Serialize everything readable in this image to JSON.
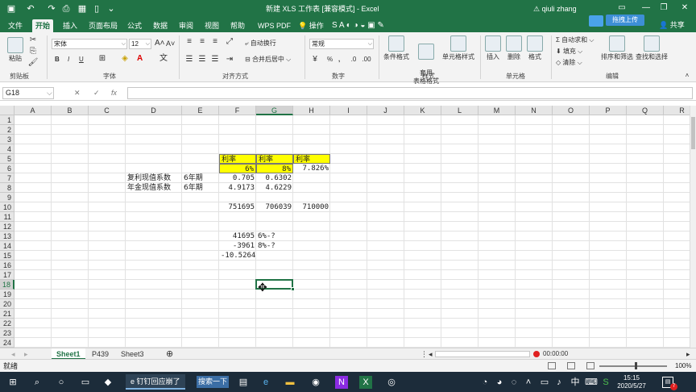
{
  "window": {
    "title": "新建 XLS 工作表 [兼容模式] - Excel",
    "user": "qiuli zhang",
    "upload_label": "拖拽上传",
    "share_label": "共享",
    "minimize": "—",
    "restore": "❐",
    "close": "✕"
  },
  "tabs": [
    "文件",
    "开始",
    "插入",
    "页面布局",
    "公式",
    "数据",
    "审阅",
    "视图",
    "帮助",
    "WPS PDF",
    "操作"
  ],
  "active_tab": "开始",
  "ribbon": {
    "clipboard": {
      "paste": "粘贴",
      "label": "剪贴板"
    },
    "font": {
      "name": "宋体",
      "size": "12",
      "label": "字体",
      "bold": "B",
      "italic": "I",
      "underline": "U",
      "grow": "A",
      "shrink": "A",
      "color_glyph": "A"
    },
    "alignment": {
      "wrap": "自动换行",
      "merge": "合并后居中",
      "label": "对齐方式"
    },
    "number": {
      "format": "常规",
      "label": "数字",
      "percent": "%",
      "comma": ","
    },
    "styles": {
      "conditional": "条件格式",
      "table": "套用\n表格格式",
      "cell_styles": "单元格样式",
      "label": "样式"
    },
    "cells": {
      "insert": "插入",
      "delete": "删除",
      "format": "格式",
      "label": "单元格"
    },
    "editing": {
      "autosum": "自动求和",
      "fill": "填充",
      "clear": "清除",
      "sort": "排序和筛选",
      "find": "查找和选择",
      "label": "编辑"
    }
  },
  "formula_bar": {
    "name_box": "G18",
    "cancel": "✕",
    "enter": "✓",
    "fx": "fx",
    "value": ""
  },
  "columns": [
    "A",
    "B",
    "C",
    "D",
    "E",
    "F",
    "G",
    "H",
    "I",
    "J",
    "K",
    "L",
    "M",
    "N",
    "O",
    "P",
    "Q",
    "R"
  ],
  "rows": [
    "1",
    "2",
    "3",
    "4",
    "5",
    "6",
    "7",
    "8",
    "9",
    "10",
    "11",
    "12",
    "13",
    "14",
    "15",
    "16",
    "17",
    "18",
    "19",
    "20",
    "21",
    "22",
    "23",
    "24"
  ],
  "selected_cell": {
    "col": "G",
    "row": "18"
  },
  "cells": {
    "F5": "利率",
    "G5": "利率",
    "H5": "利率",
    "F6": "6%",
    "G6": "8%",
    "H6": "7.826%",
    "D7": "复利现值系数",
    "E7": "6年期",
    "F7": "0.705",
    "G7": "0.6302",
    "D8": "年金现值系数",
    "E8": "6年期",
    "F8": "4.9173",
    "G8": "4.6229",
    "F10": "751695",
    "G10": "706039",
    "H10": "710000",
    "F13": "41695",
    "G13": "6%-?",
    "F14": "-3961",
    "G14": "8%-?",
    "F15": "-10.5264"
  },
  "sheets": [
    "Sheet1",
    "P439",
    "Sheet3"
  ],
  "active_sheet": "Sheet1",
  "add_sheet": "⊕",
  "recording_time": "00:00:00",
  "status": {
    "text": "就绪",
    "zoom": "100%"
  },
  "taskbar": {
    "app_title": "钉钉回应崩了",
    "search_label": "搜索一下",
    "time": "15:15",
    "date": "2020/5/27",
    "input_method": "中",
    "notification_count": "7"
  },
  "colors": {
    "excel_green": "#217346",
    "highlight_yellow": "#ffff00",
    "taskbar": "#1c2c3a"
  }
}
